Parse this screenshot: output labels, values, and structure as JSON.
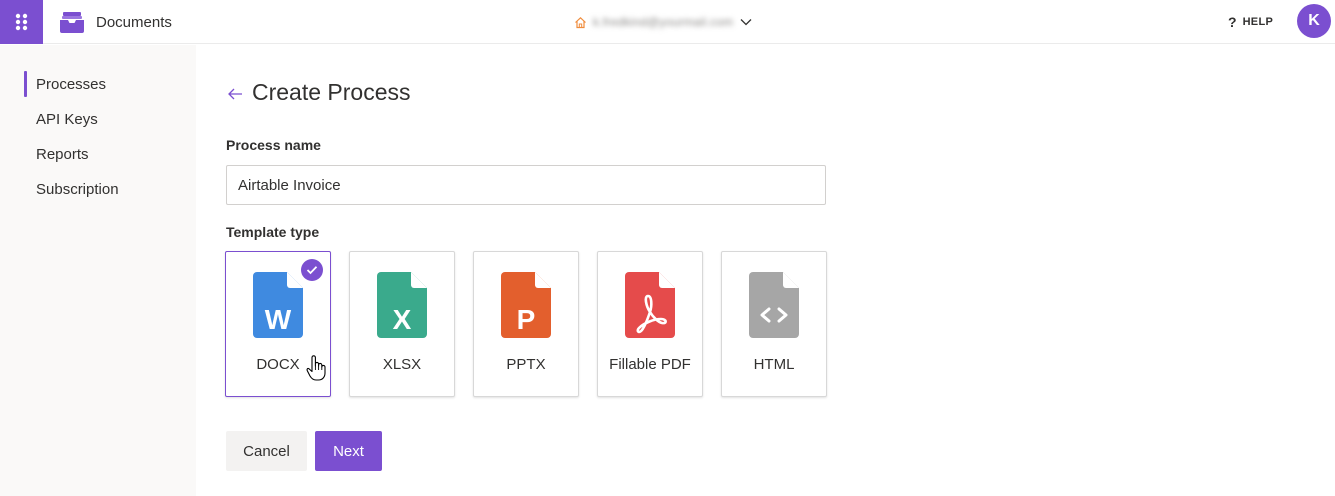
{
  "header": {
    "app_title": "Documents",
    "account_email": "k.fredkind@yourmail.com",
    "help_label": "HELP",
    "help_symbol": "?",
    "avatar_initial": "K"
  },
  "sidebar": {
    "items": [
      {
        "label": "Processes",
        "active": true
      },
      {
        "label": "API Keys",
        "active": false
      },
      {
        "label": "Reports",
        "active": false
      },
      {
        "label": "Subscription",
        "active": false
      }
    ]
  },
  "page": {
    "title": "Create Process",
    "process_name_label": "Process name",
    "process_name_value": "Airtable Invoice",
    "template_type_label": "Template type"
  },
  "templates": [
    {
      "label": "DOCX",
      "letter": "W",
      "color": "#3f8ae0",
      "icon": "word-file-icon",
      "selected": true
    },
    {
      "label": "XLSX",
      "letter": "X",
      "color": "#3aaa8c",
      "icon": "excel-file-icon",
      "selected": false
    },
    {
      "label": "PPTX",
      "letter": "P",
      "color": "#e35f2d",
      "icon": "powerpoint-file-icon",
      "selected": false
    },
    {
      "label": "Fillable PDF",
      "letter": "",
      "color": "#e54b4b",
      "icon": "pdf-file-icon",
      "selected": false
    },
    {
      "label": "HTML",
      "letter": "",
      "color": "#a6a6a6",
      "icon": "html-file-icon",
      "selected": false
    }
  ],
  "actions": {
    "cancel_label": "Cancel",
    "next_label": "Next"
  },
  "colors": {
    "accent": "#7b4fd0",
    "text": "#323130",
    "sidebar_bg": "#faf9f8",
    "home_icon": "#f08c3c"
  }
}
